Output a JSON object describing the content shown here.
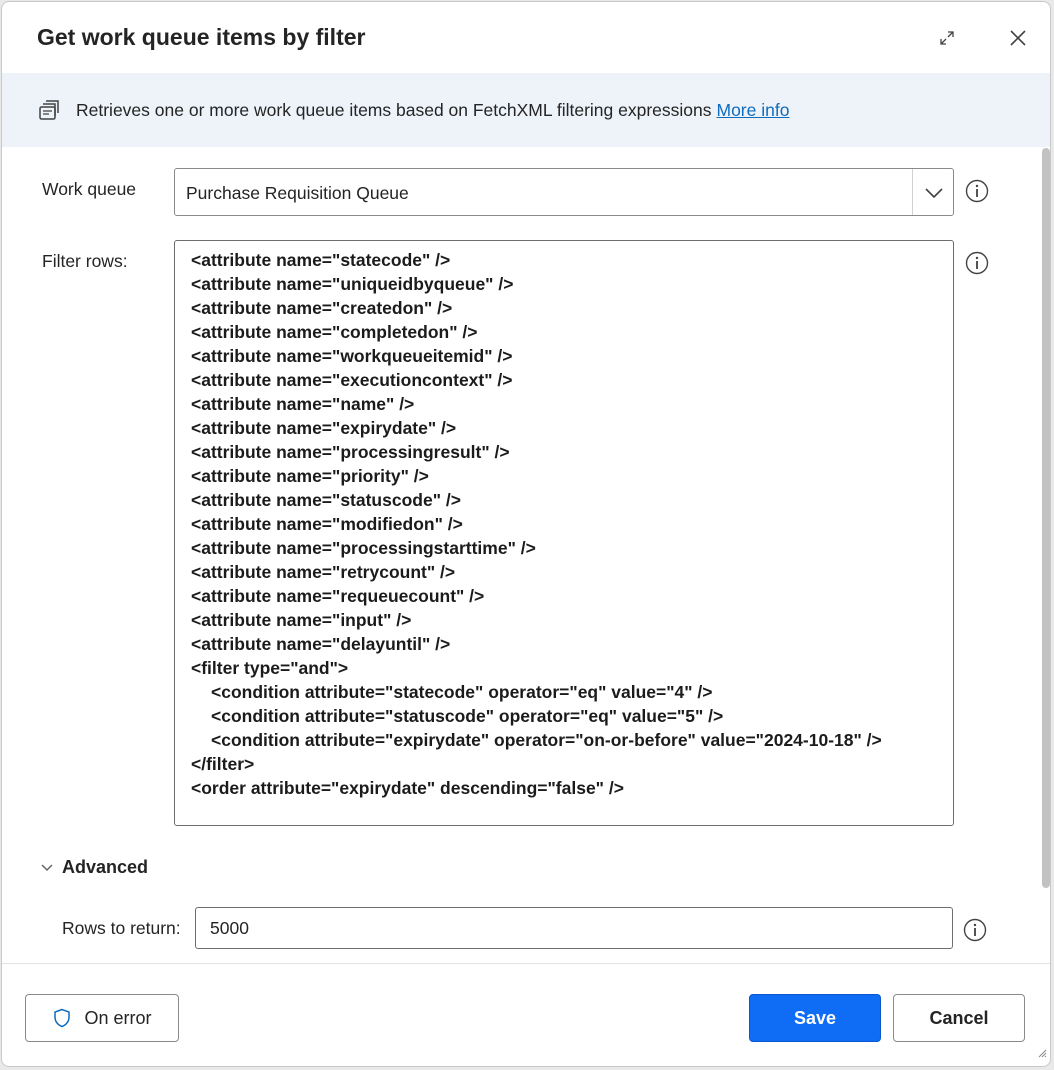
{
  "dialog": {
    "title": "Get work queue items by filter",
    "icons": {
      "expand": "expand-icon",
      "close": "close-icon"
    }
  },
  "banner": {
    "icon": "work-queue-icon",
    "text": "Retrieves one or more work queue items based on FetchXML filtering expressions",
    "link": "More info"
  },
  "fields": {
    "work_queue": {
      "label": "Work queue",
      "value": "Purchase Requisition Queue"
    },
    "filter_rows": {
      "label": "Filter rows:",
      "lines": [
        "<attribute name=\"statecode\" />",
        "<attribute name=\"uniqueidbyqueue\" />",
        "<attribute name=\"createdon\" />",
        "<attribute name=\"completedon\" />",
        "<attribute name=\"workqueueitemid\" />",
        "<attribute name=\"executioncontext\" />",
        "<attribute name=\"name\" />",
        "<attribute name=\"expirydate\" />",
        "<attribute name=\"processingresult\" />",
        "<attribute name=\"priority\" />",
        "<attribute name=\"statuscode\" />",
        "<attribute name=\"modifiedon\" />",
        "<attribute name=\"processingstarttime\" />",
        "<attribute name=\"retrycount\" />",
        "<attribute name=\"requeuecount\" />",
        "<attribute name=\"input\" />",
        "<attribute name=\"delayuntil\" />",
        "<filter type=\"and\">",
        "<condition attribute=\"statecode\" operator=\"eq\" value=\"4\" />",
        "<condition attribute=\"statuscode\" operator=\"eq\" value=\"5\" />",
        "<condition attribute=\"expirydate\" operator=\"on-or-before\" value=\"2024-10-18\" />",
        "</filter>",
        "<order attribute=\"expirydate\" descending=\"false\" />"
      ]
    },
    "advanced": {
      "label": "Advanced",
      "expanded": true
    },
    "rows_to_return": {
      "label": "Rows to return:",
      "value": "5000"
    }
  },
  "footer": {
    "on_error": "On error",
    "save": "Save",
    "cancel": "Cancel"
  },
  "colors": {
    "accent": "#0f6cf5",
    "link": "#0f6cbd",
    "banner_bg": "#eef3fa"
  }
}
